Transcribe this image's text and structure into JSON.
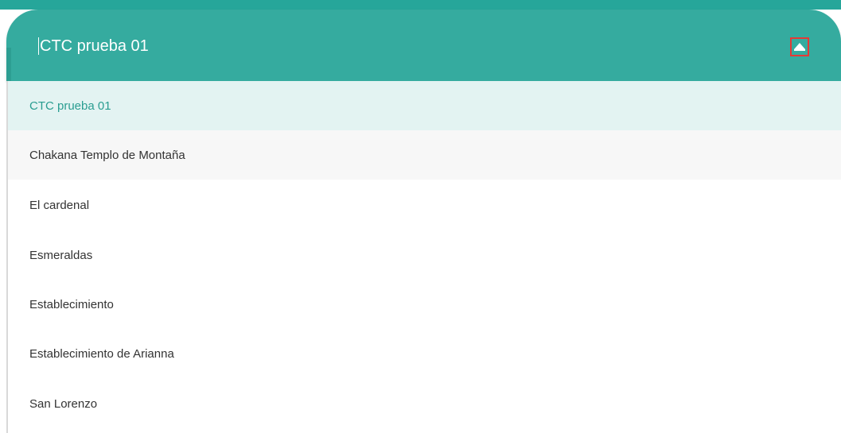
{
  "select": {
    "value": "CTC prueba 01",
    "toggle_icon": "caret-up-icon"
  },
  "options": [
    {
      "label": "CTC prueba 01"
    },
    {
      "label": "Chakana Templo de Montaña"
    },
    {
      "label": "El cardenal"
    },
    {
      "label": "Esmeraldas"
    },
    {
      "label": "Establecimiento"
    },
    {
      "label": "Establecimiento de Arianna"
    },
    {
      "label": "San Lorenzo"
    }
  ],
  "colors": {
    "header": "#35ab9f",
    "accent": "#26a69a",
    "selected_bg": "#e3f3f2",
    "selected_text": "#2a9d91",
    "highlight_border": "#e53935"
  }
}
